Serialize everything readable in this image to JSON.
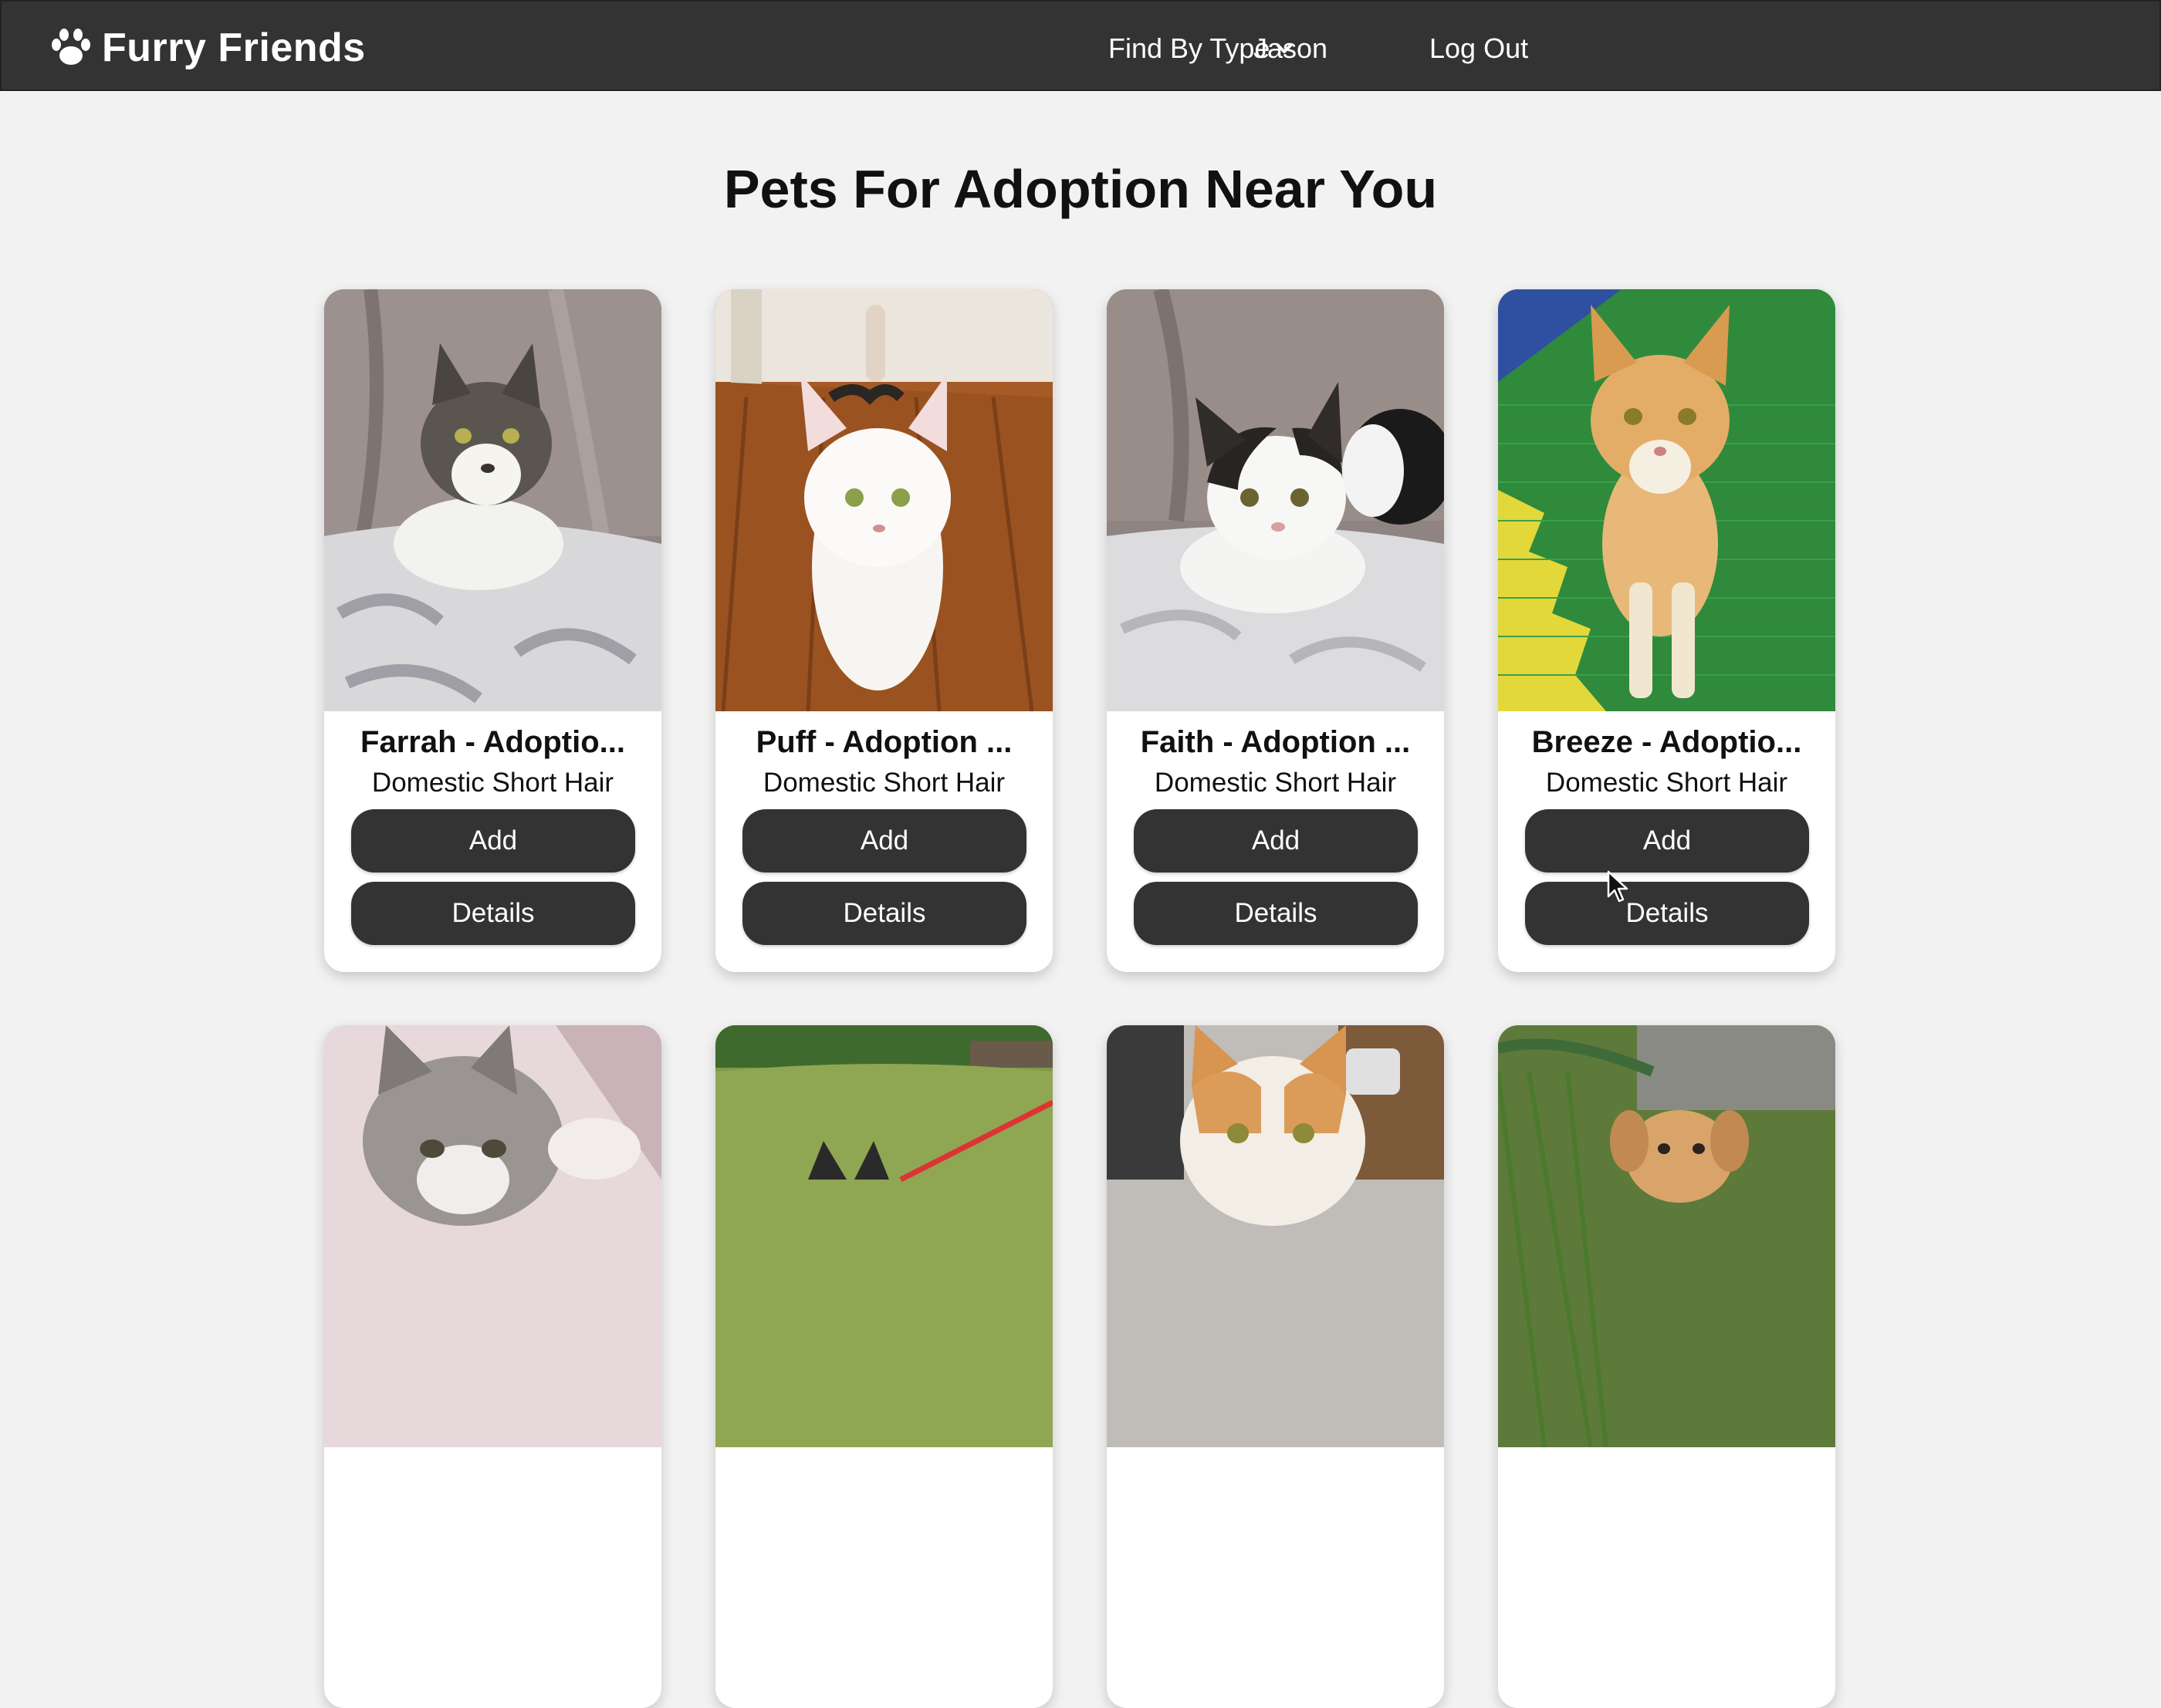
{
  "navbar": {
    "brand": "Furry Friends",
    "brand_icon": "paw-icon",
    "find_by_type": "Find By Type",
    "user": "Jason",
    "logout": "Log Out"
  },
  "page": {
    "title": "Pets For Adoption Near You"
  },
  "pets": [
    {
      "name": "Farrah - Adoptio...",
      "breed": "Domestic Short Hair",
      "add": "Add",
      "details": "Details"
    },
    {
      "name": "Puff - Adoption ...",
      "breed": "Domestic Short Hair",
      "add": "Add",
      "details": "Details"
    },
    {
      "name": "Faith - Adoption ...",
      "breed": "Domestic Short Hair",
      "add": "Add",
      "details": "Details"
    },
    {
      "name": "Breeze - Adoptio...",
      "breed": "Domestic Short Hair",
      "add": "Add",
      "details": "Details"
    }
  ],
  "colors": {
    "navbar": "#333333",
    "button": "#333333",
    "background": "#f2f2f2"
  }
}
